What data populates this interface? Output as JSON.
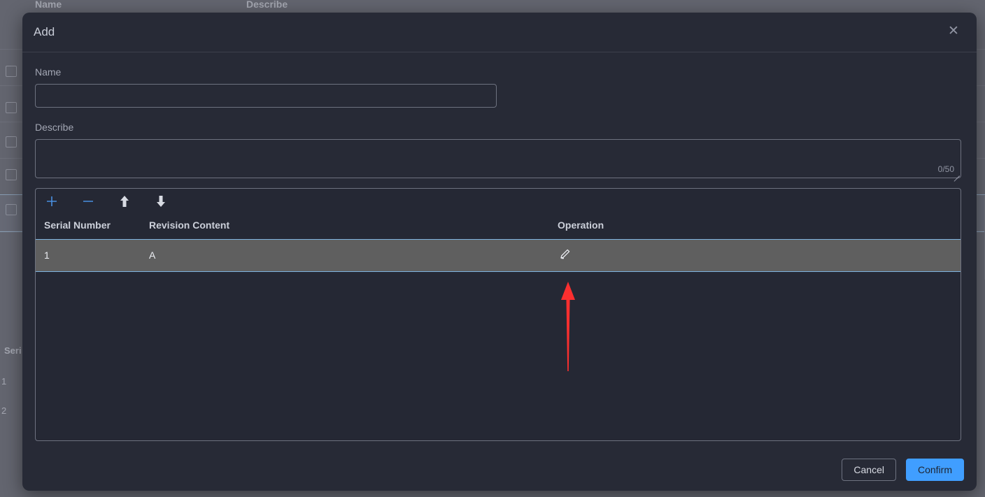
{
  "background": {
    "table_headers": [
      "Name",
      "Describe"
    ],
    "sub_table_header": "Seri",
    "sub_rows": [
      "1",
      "2"
    ]
  },
  "modal": {
    "title": "Add",
    "close_icon": "close-icon",
    "fields": {
      "name": {
        "label": "Name",
        "value": "",
        "placeholder": ""
      },
      "describe": {
        "label": "Describe",
        "value": "",
        "placeholder": "",
        "counter": "0/50"
      }
    },
    "table": {
      "toolbar": [
        {
          "name": "add-row-button",
          "icon": "plus-icon",
          "color": "#4a90e2"
        },
        {
          "name": "remove-row-button",
          "icon": "minus-icon",
          "color": "#4a90e2"
        },
        {
          "name": "move-up-button",
          "icon": "arrow-up-icon",
          "color": "#d8dbe3"
        },
        {
          "name": "move-down-button",
          "icon": "arrow-down-icon",
          "color": "#d8dbe3"
        }
      ],
      "columns": [
        "Serial Number",
        "Revision Content",
        "Operation"
      ],
      "rows": [
        {
          "serial_number": "1",
          "revision_content": "A",
          "operation_icon": "pencil-edit-icon"
        }
      ]
    },
    "footer": {
      "cancel_label": "Cancel",
      "confirm_label": "Confirm"
    }
  },
  "annotation": {
    "arrow_color": "#fa2f2f",
    "points_at": "pencil-edit-icon"
  },
  "colors": {
    "modal_bg": "#272a36",
    "page_bg": "#21232e",
    "accent": "#409eff",
    "row_selected_bg": "#5f5f5f",
    "row_selected_border": "#7fb4e0"
  }
}
